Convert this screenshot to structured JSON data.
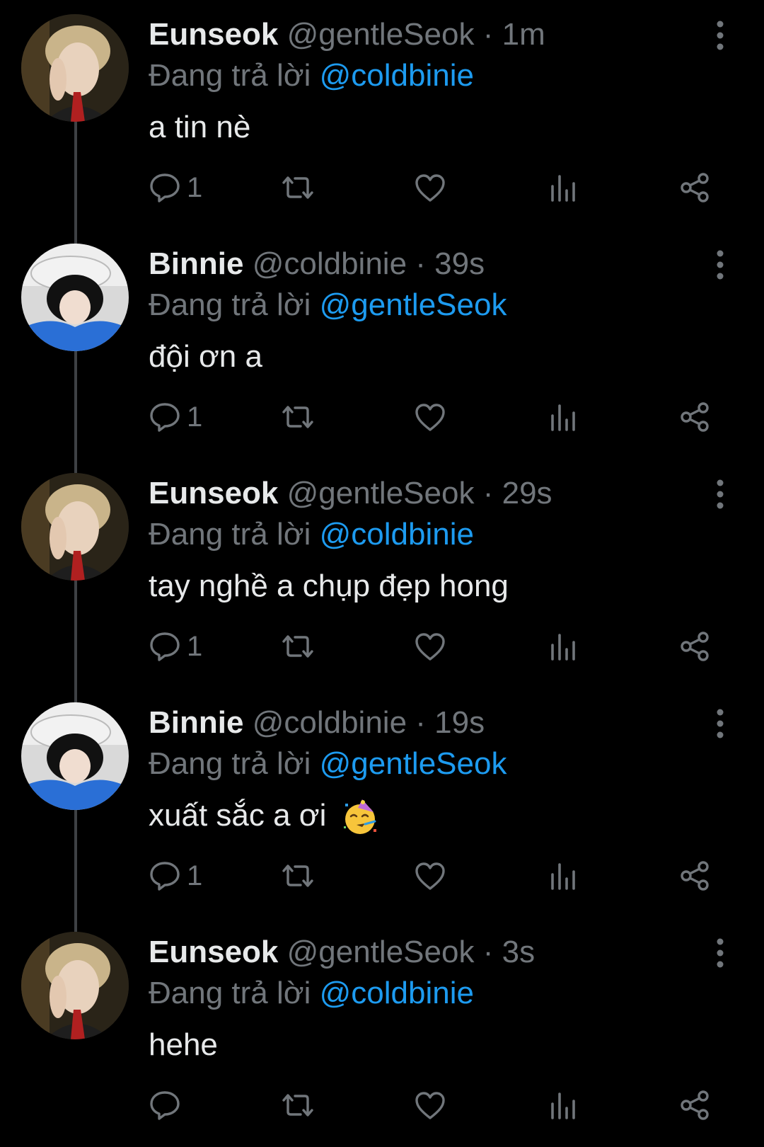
{
  "colors": {
    "background": "#000000",
    "primary_text": "#e7e9ea",
    "secondary_text": "#71767b",
    "mention": "#1d9bf0",
    "thread_line": "#3e4144"
  },
  "icons": {
    "reply": "comment-bubble-icon",
    "retweet": "retweet-arrows-icon",
    "like": "heart-outline-icon",
    "views": "bar-chart-icon",
    "share": "share-nodes-icon",
    "more": "vertical-dots-icon"
  },
  "reply_prefix": "Đang trả lời",
  "dot": "·",
  "tweets": [
    {
      "name": "Eunseok",
      "handle": "@gentleSeok",
      "time": "1m",
      "reply_to": "@coldbinie",
      "text": "a tin nè",
      "reply_count": "1",
      "avatar": "eunseok"
    },
    {
      "name": "Binnie",
      "handle": "@coldbinie",
      "time": "39s",
      "reply_to": "@gentleSeok",
      "text": "đội ơn a",
      "reply_count": "1",
      "avatar": "binnie"
    },
    {
      "name": "Eunseok",
      "handle": "@gentleSeok",
      "time": "29s",
      "reply_to": "@coldbinie",
      "text": "tay nghề a chụp đẹp hong",
      "reply_count": "1",
      "avatar": "eunseok"
    },
    {
      "name": "Binnie",
      "handle": "@coldbinie",
      "time": "19s",
      "reply_to": "@gentleSeok",
      "text": "xuất sắc a ơi",
      "emoji": "partying-face-emoji",
      "reply_count": "1",
      "avatar": "binnie"
    },
    {
      "name": "Eunseok",
      "handle": "@gentleSeok",
      "time": "3s",
      "reply_to": "@coldbinie",
      "text": "hehe",
      "reply_count": "",
      "avatar": "eunseok"
    }
  ]
}
